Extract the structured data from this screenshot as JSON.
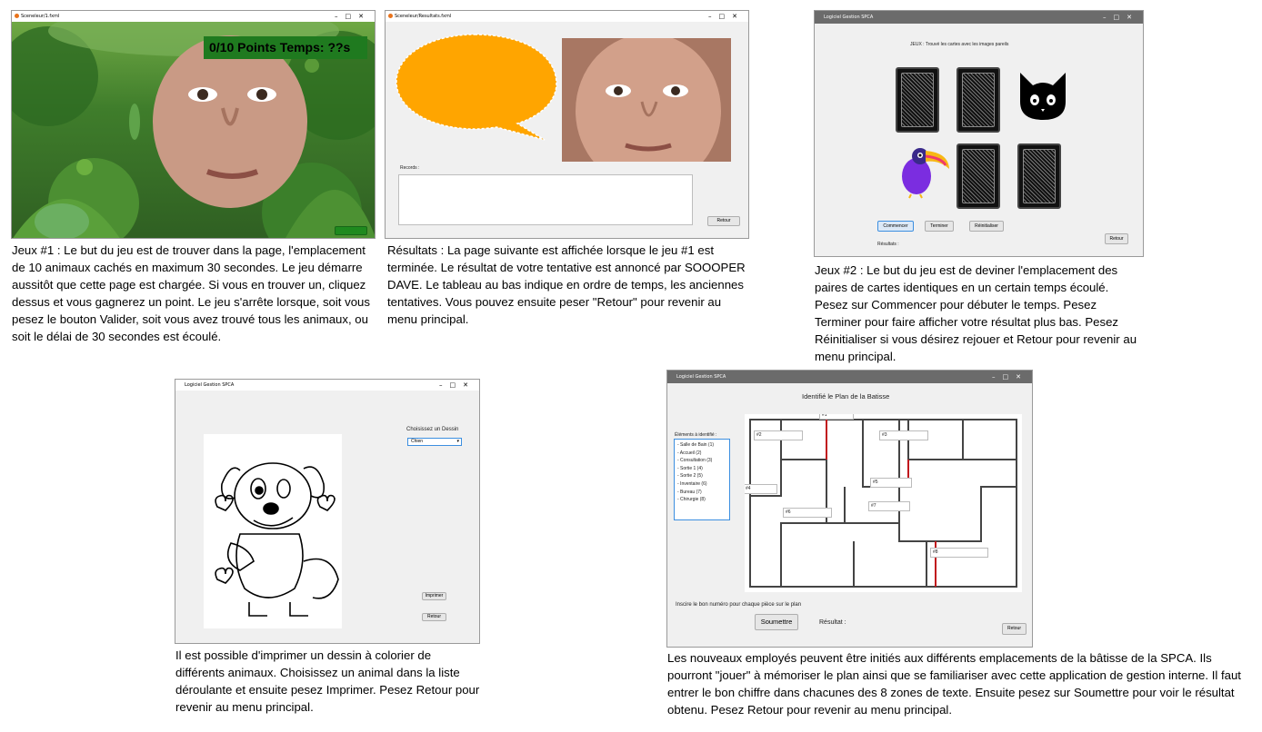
{
  "game1": {
    "window_title": "Sceneleur/1.fxml",
    "score_label": "0/10 Points   Temps: ??s",
    "valider_label": "Valider",
    "caption": "Jeux #1 : Le but du jeu est de trouver dans la page, l'emplacement de 10 animaux cachés en maximum 30 secondes. Le jeu démarre aussitôt que cette page est chargée. Si vous en trouver un, cliquez dessus et vous gagnerez un point. Le jeu s'arrête lorsque, soit vous pesez le bouton Valider, soit vous avez trouvé tous les animaux, ou soit le délai de 30 secondes est écoulé."
  },
  "results": {
    "window_title": "Sceneleur/Resultats.fxml",
    "records_label": "Records :",
    "retour_label": "Retour",
    "caption": "Résultats : La page suivante est affichée lorsque le jeu #1 est terminée. Le résultat de votre tentative est annoncé par SOOOPER DAVE. Le tableau au bas indique en ordre de temps, les anciennes tentatives. Vous pouvez ensuite peser \"Retour\" pour revenir au menu principal."
  },
  "game2": {
    "window_title": "Logiciel Gestion SPCA",
    "heading": "JEUX : Trouvé les cartes avec les images pareils",
    "commencer_label": "Commencer",
    "terminer_label": "Terminer",
    "reinit_label": "Réinitialiser",
    "resultats_label": "Résultats :",
    "retour_label": "Retour",
    "caption": "Jeux #2 : Le but du jeu est de deviner l'emplacement des paires de cartes identiques en un certain temps écoulé. Pesez sur Commencer pour débuter le temps. Pesez Terminer pour faire afficher votre résultat plus bas. Pesez Réinitialiser si vous désirez rejouer et Retour pour revenir au menu principal."
  },
  "coloring": {
    "window_title": "Logiciel Gestion SPCA",
    "choose_label": "Choisissez un Dessin",
    "select_value": "Chien",
    "imprimer_label": "Imprimer",
    "retour_label": "Retour",
    "caption": "Il est possible d'imprimer un dessin à colorier de différents animaux. Choisissez un animal dans la liste déroulante et ensuite pesez Imprimer. Pesez Retour pour revenir au menu principal."
  },
  "plan": {
    "window_title": "Logiciel Gestion SPCA",
    "heading": "Identifié le Plan de la Batisse",
    "list_label": "Éléments à identifié :",
    "items": [
      "- Salle de Bain (1)",
      "- Accueil (2)",
      "- Consultation (3)",
      "- Sortie 1 (4)",
      "- Sortie 2 (5)",
      "- Inventaire (6)",
      "- Bureau (7)",
      "- Chirurgie (8)"
    ],
    "zones": [
      "#1",
      "#2",
      "#3",
      "#4",
      "#5",
      "#6",
      "#7",
      "#8"
    ],
    "instruction": "Inscire le bon numéro pour chaque pièce sur le plan",
    "soumettre_label": "Soumettre",
    "resultat_label": "Résultat :",
    "retour_label": "Retour",
    "caption": "Les nouveaux employés peuvent être initiés aux différents emplacements de la bâtisse de la SPCA. Ils pourront \"jouer\" à mémoriser le plan ainsi que se familiariser avec cette application de gestion interne. Il faut entrer le bon chiffre dans chacunes des 8 zones de texte. Ensuite pesez sur Soumettre pour voir le résultat obtenu. Pesez Retour pour revenir au menu principal."
  },
  "colors": {
    "jungle": "#3d7a2a",
    "score_bg": "#1f7a1f",
    "bubble": "#ffa500",
    "plan_red": "#c0141c"
  }
}
